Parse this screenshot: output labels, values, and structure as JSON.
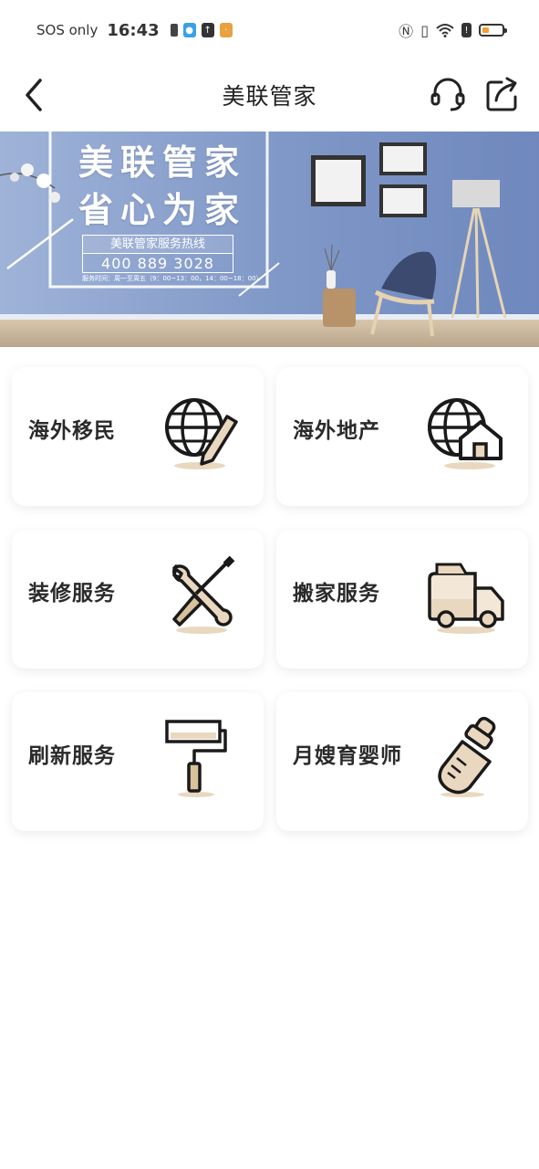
{
  "status_bar": {
    "carrier": "SOS only",
    "time": "16:43",
    "icons": [
      "battery-saver-icon",
      "chat-app-icon",
      "upload-icon",
      "app-notification-icon",
      "nfc-icon",
      "vibrate-icon",
      "wifi-icon",
      "alert-icon",
      "battery-icon"
    ],
    "battery_level": 0.3
  },
  "nav": {
    "title": "美联管家",
    "back_icon": "chevron-left-icon",
    "support_icon": "headset-icon",
    "share_icon": "share-icon"
  },
  "banner": {
    "title_line1": "美联管家",
    "title_line2": "省心为家",
    "hotline_label": "美联管家服务热线",
    "hotline_number": "400 889 3028",
    "hours": "服务时间：周一至周五（9：00~13：00，14：00~18：00）"
  },
  "services": [
    {
      "label": "海外移民",
      "icon": "globe-pencil-icon"
    },
    {
      "label": "海外地产",
      "icon": "globe-house-icon"
    },
    {
      "label": "装修服务",
      "icon": "tools-icon"
    },
    {
      "label": "搬家服务",
      "icon": "moving-truck-icon"
    },
    {
      "label": "刷新服务",
      "icon": "paint-roller-icon"
    },
    {
      "label": "月嫂育婴师",
      "icon": "baby-bottle-icon"
    }
  ],
  "colors": {
    "accent_beige": "#e9d8bf",
    "icon_dark": "#1a1a1a",
    "banner_blue": "#7d95c4"
  }
}
